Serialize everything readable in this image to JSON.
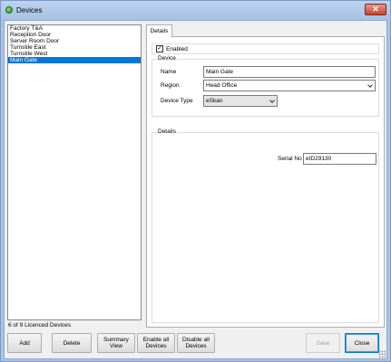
{
  "window": {
    "title": "Devices",
    "close_glyph": "✕"
  },
  "device_list": [
    {
      "label": "Factory T&A",
      "selected": false
    },
    {
      "label": "Reception Door",
      "selected": false
    },
    {
      "label": "Server Room Door",
      "selected": false
    },
    {
      "label": "Turnstile East",
      "selected": false
    },
    {
      "label": "Turnstile West",
      "selected": false
    },
    {
      "label": "Main Gate",
      "selected": true
    }
  ],
  "tab": {
    "label": "Details"
  },
  "enabled": {
    "label": "Enabled",
    "checked": true,
    "check_glyph": "✓"
  },
  "device_group": {
    "label": "Device",
    "name_label": "Name",
    "name_value": "Main Gate",
    "region_label": "Region",
    "region_value": "Head Office",
    "type_label": "Device Type",
    "type_value": "eSkan"
  },
  "details_group": {
    "label": "Details",
    "serial_label": "Serial No",
    "serial_value": "eID29130"
  },
  "status": {
    "licence_text": "6 of 9 Licenced Devices"
  },
  "buttons": {
    "add": "Add",
    "delete": "Delete",
    "summary": "Summary\nView",
    "enable_all": "Enable all\nDevices",
    "disable_all": "Disable all\nDevices",
    "save": "Save",
    "close": "Close"
  },
  "icons": {
    "app": "green-orb-icon",
    "close": "close-icon",
    "check": "check-icon",
    "dropdown": "chevron-down-icon"
  },
  "colors": {
    "selection": "#0078d7",
    "titlebar": "#a9c4e6",
    "close_button": "#c2442e"
  }
}
